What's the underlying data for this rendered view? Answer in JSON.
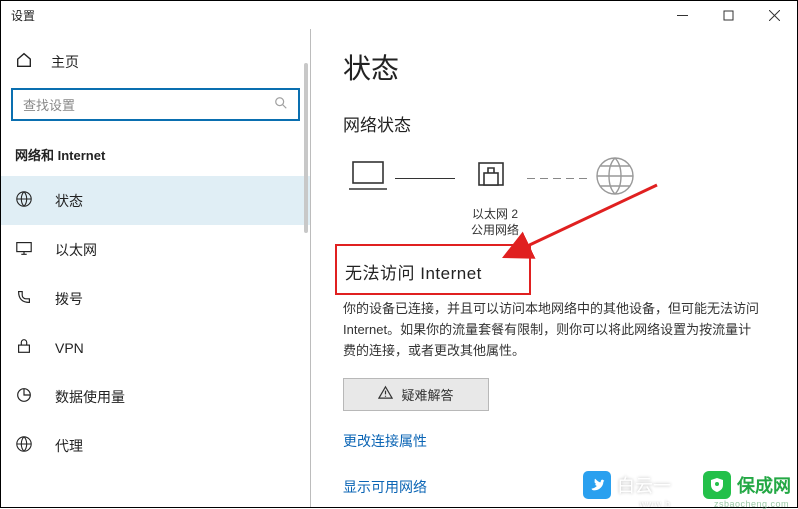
{
  "window": {
    "title": "设置"
  },
  "sidebar": {
    "home": "主页",
    "search_placeholder": "查找设置",
    "category": "网络和 Internet",
    "items": [
      {
        "label": "状态"
      },
      {
        "label": "以太网"
      },
      {
        "label": "拨号"
      },
      {
        "label": "VPN"
      },
      {
        "label": "数据使用量"
      },
      {
        "label": "代理"
      }
    ]
  },
  "content": {
    "page_title": "状态",
    "section_title": "网络状态",
    "diagram": {
      "adapter_name": "以太网 2",
      "adapter_type": "公用网络"
    },
    "no_internet": "无法访问 Internet",
    "description": "你的设备已连接，并且可以访问本地网络中的其他设备，但可能无法访问 Internet。如果你的流量套餐有限制，则你可以将此网络设置为按流量计费的连接，或者更改其他属性。",
    "troubleshoot_label": "疑难解答",
    "link_change_props": "更改连接属性",
    "link_show_networks": "显示可用网络"
  },
  "watermarks": {
    "a_text": "白云一",
    "a_sub": "www.b",
    "b_text": "保成网",
    "b_sub": "zsbaocheng.com"
  }
}
